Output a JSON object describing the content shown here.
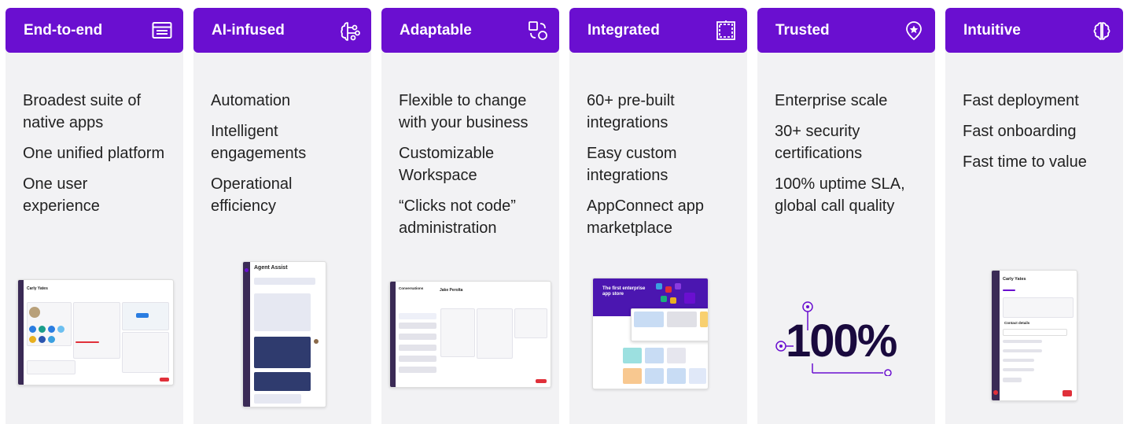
{
  "cards": [
    {
      "title": "End-to-end",
      "icon": "browser-window-icon",
      "items": [
        "Broadest suite of native apps",
        "One unified platform",
        "One user experience"
      ]
    },
    {
      "title": "AI-infused",
      "icon": "ai-brain-circuit-icon",
      "items": [
        "Automation",
        "Intelligent engagements",
        "Operational efficiency"
      ]
    },
    {
      "title": "Adaptable",
      "icon": "shapes-transform-icon",
      "items": [
        "Flexible to change with your business",
        "Customizable Workspace",
        "“Clicks not code” administration"
      ]
    },
    {
      "title": "Integrated",
      "icon": "integration-box-icon",
      "items": [
        "60+ pre-built integrations",
        "Easy custom integrations",
        "AppConnect app marketplace"
      ]
    },
    {
      "title": "Trusted",
      "icon": "shield-star-badge-icon",
      "items": [
        "Enterprise scale",
        "30+ security certifications",
        "100% uptime SLA, global call quality"
      ]
    },
    {
      "title": "Intuitive",
      "icon": "brain-icon",
      "items": [
        "Fast deployment",
        "Fast onboarding",
        "Fast time to value"
      ]
    }
  ],
  "screens": {
    "end_to_end": {
      "contact_name": "Carly Yates"
    },
    "ai_infused": {
      "panel_title": "Agent Assist"
    },
    "adaptable": {
      "panel_title": "Conversations",
      "contact_name": "Jake Perolta"
    },
    "integrated": {
      "hero_text": "The first enterprise app store"
    },
    "trusted": {
      "big_number": "100%"
    },
    "intuitive": {
      "contact_name": "Carly Yates",
      "section_title": "Contact details"
    }
  },
  "colors": {
    "header_bg": "#6a0fd0",
    "card_bg": "#f2f2f4",
    "text": "#222222",
    "accent_red": "#e0303a"
  }
}
